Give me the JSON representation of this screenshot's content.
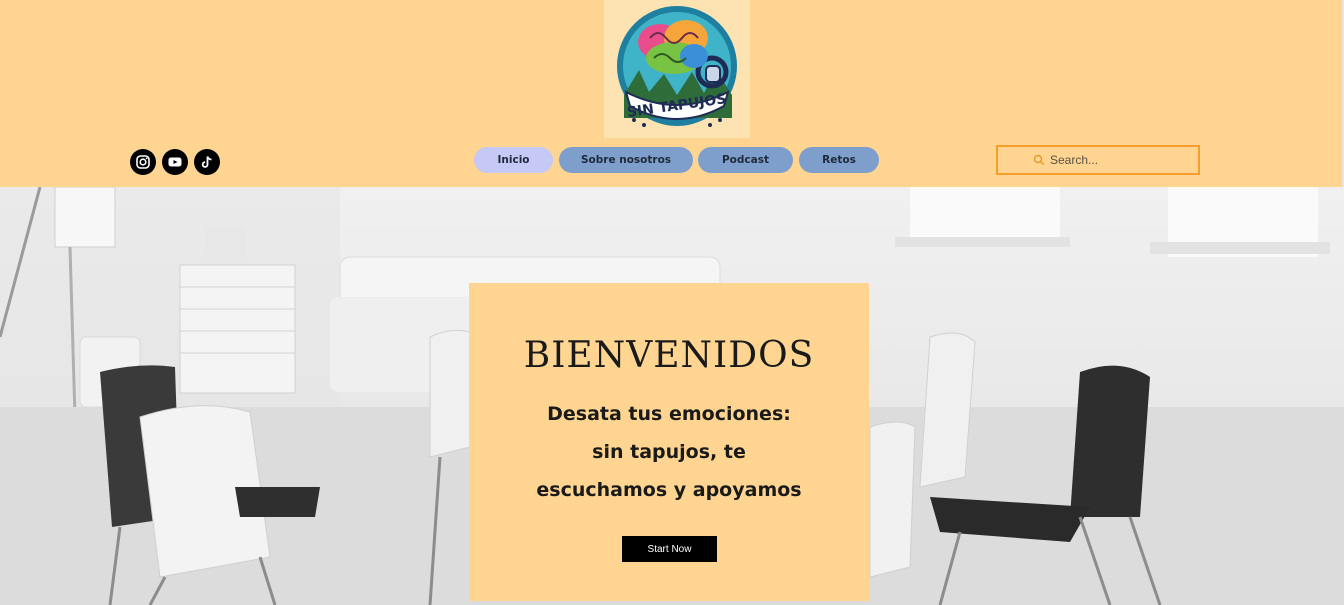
{
  "header": {
    "logo": {
      "text": "SIN TAPUJOS",
      "icon": "brain-headphones-logo"
    },
    "social": [
      {
        "name": "instagram",
        "icon": "instagram-icon"
      },
      {
        "name": "youtube",
        "icon": "youtube-icon"
      },
      {
        "name": "tiktok",
        "icon": "tiktok-icon"
      }
    ],
    "nav": [
      {
        "label": "Inicio",
        "active": true
      },
      {
        "label": "Sobre nosotros",
        "active": false
      },
      {
        "label": "Podcast",
        "active": false
      },
      {
        "label": "Retos",
        "active": false
      }
    ],
    "search": {
      "placeholder": "Search...",
      "value": ""
    }
  },
  "hero": {
    "title": "BIENVENIDOS",
    "subtitle": "Desata tus emociones: sin tapujos, te escuchamos y apoyamos",
    "cta_label": "Start Now"
  },
  "colors": {
    "header_bg": "#ffd591",
    "nav_active": "#c6c8f5",
    "nav_default": "#7e9fcb",
    "search_border": "#f59e2c",
    "cta_bg": "#000000"
  }
}
